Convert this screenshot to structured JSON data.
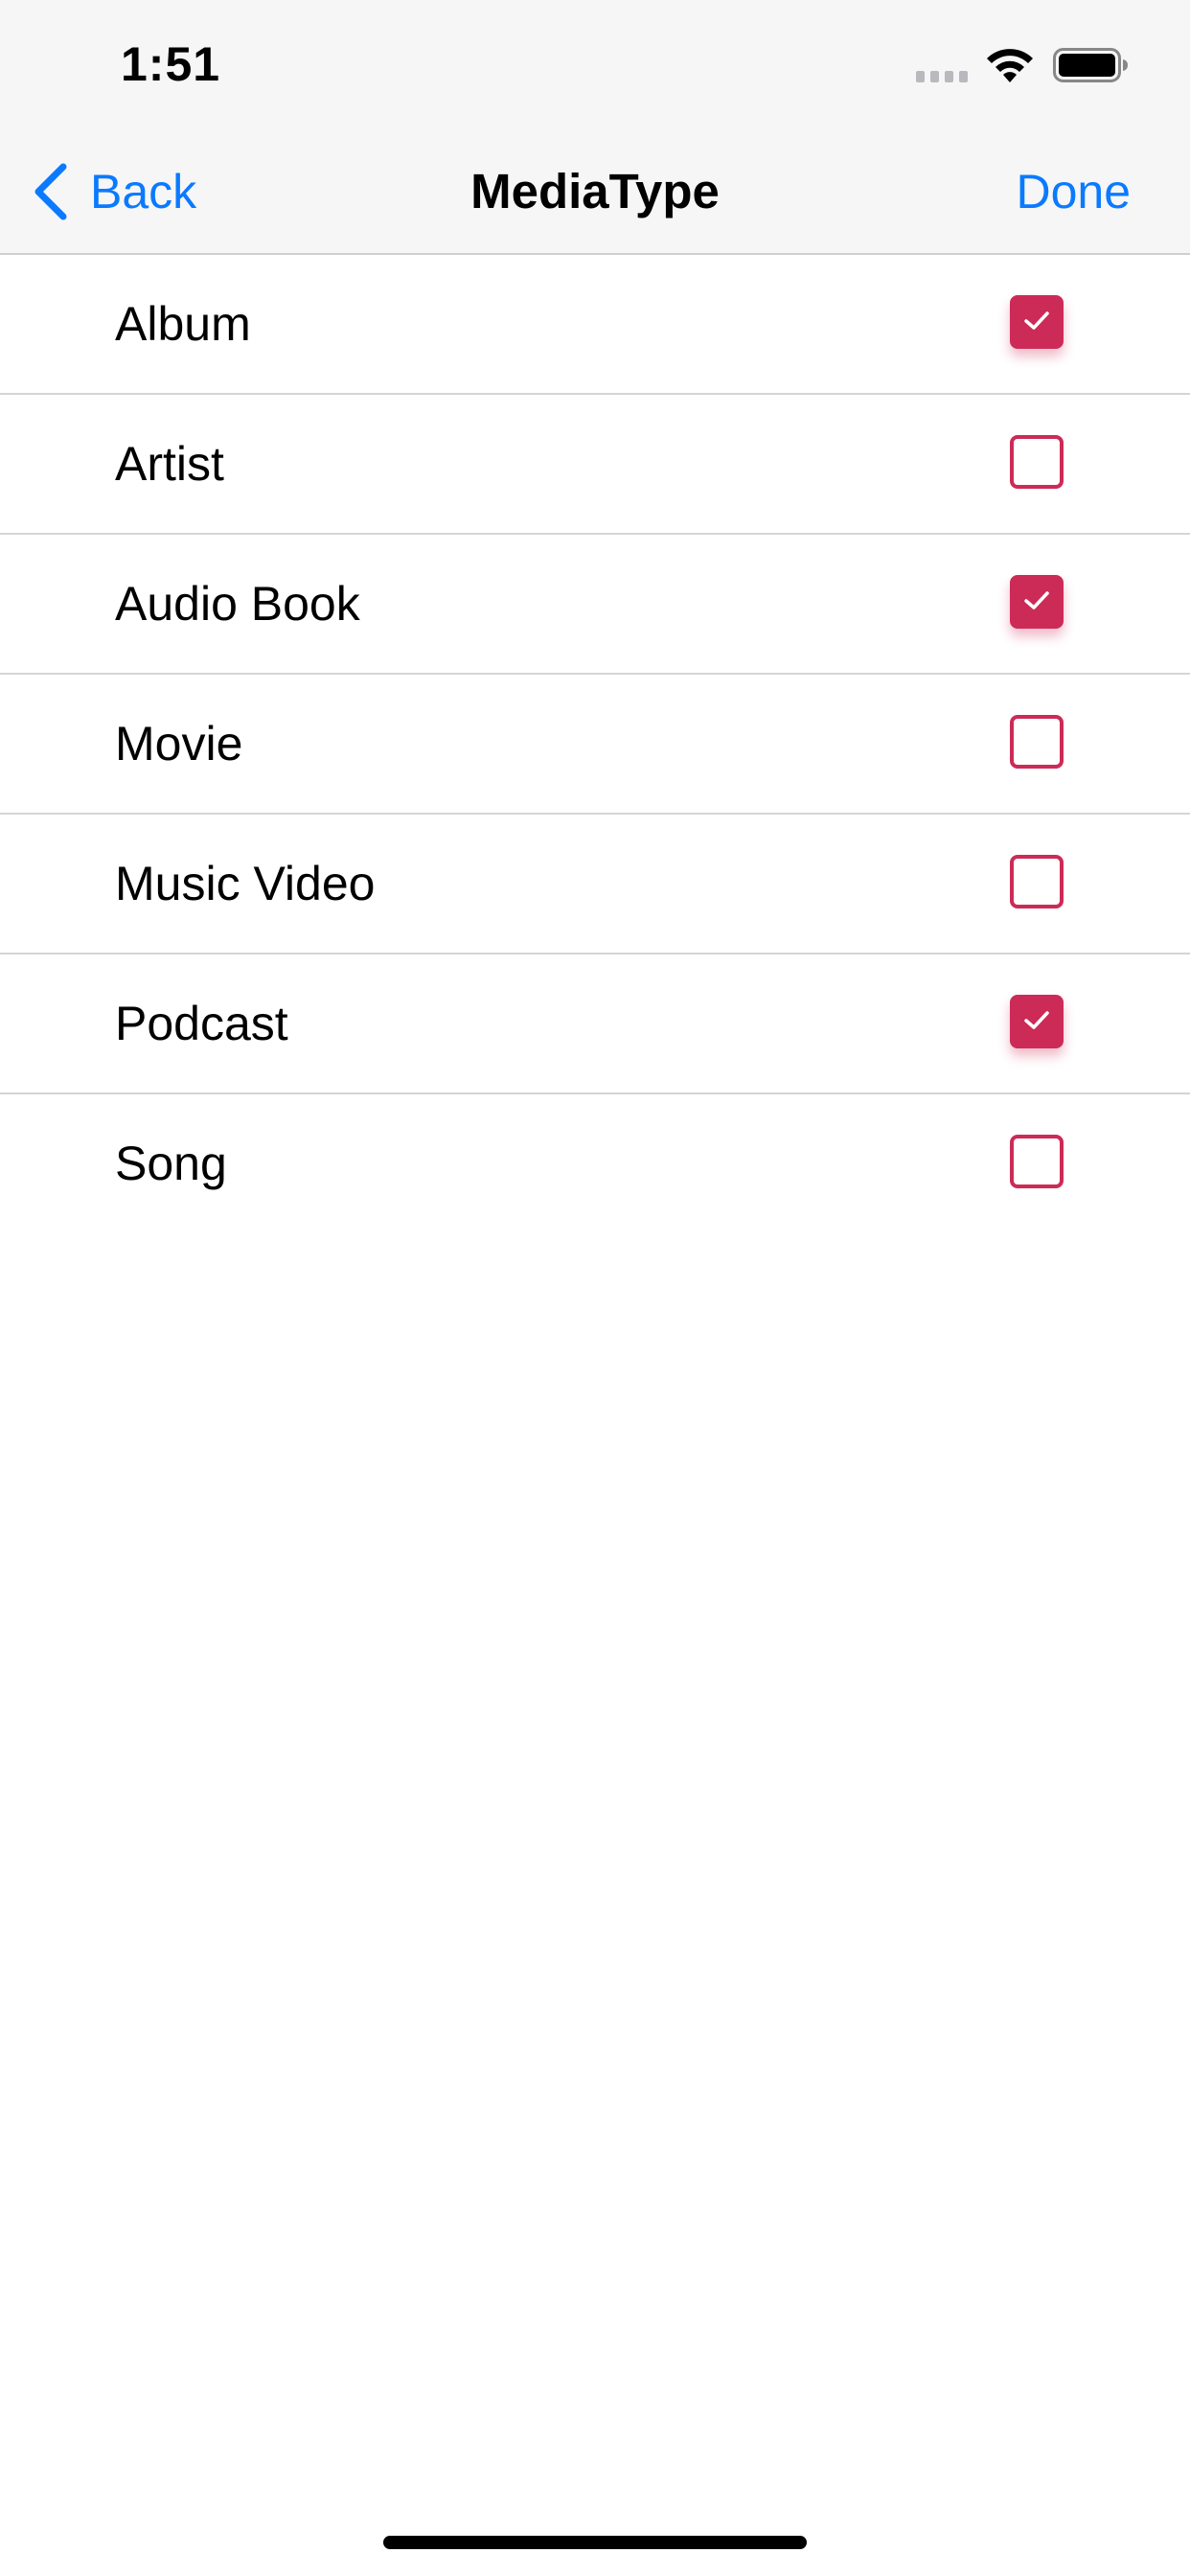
{
  "status_bar": {
    "time": "1:51",
    "wifi_icon": "wifi-icon",
    "battery_icon": "battery-icon"
  },
  "nav_bar": {
    "back_label": "Back",
    "title": "MediaType",
    "done_label": "Done",
    "accent_color": "#0a7aff"
  },
  "options": [
    {
      "label": "Album",
      "checked": true
    },
    {
      "label": "Artist",
      "checked": false
    },
    {
      "label": "Audio Book",
      "checked": true
    },
    {
      "label": "Movie",
      "checked": false
    },
    {
      "label": "Music Video",
      "checked": false
    },
    {
      "label": "Podcast",
      "checked": true
    },
    {
      "label": "Song",
      "checked": false
    }
  ],
  "checkbox_color": "#cc2b57"
}
